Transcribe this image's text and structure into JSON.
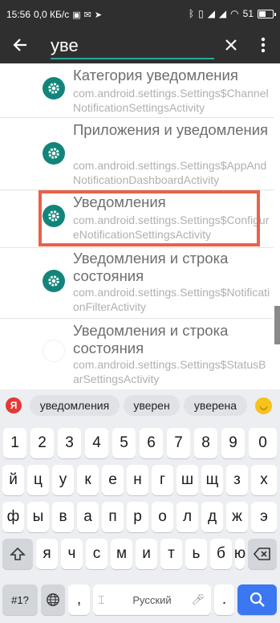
{
  "status": {
    "time": "15:56",
    "speed": "0,0 КБ/с",
    "battery": "51",
    "battery_level": 0.51
  },
  "search": {
    "query": "уве"
  },
  "results": [
    {
      "title": "Категория уведомления",
      "subtitle": "com.android.settings.Settings$ChannelNotificationSettingsActivity",
      "icon": "gear-icon"
    },
    {
      "title": "Приложения и уведомления",
      "subtitle": "com.android.settings.Settings$AppAndNotificationDashboardActivity",
      "icon": "gear-icon"
    },
    {
      "title": "Уведомления",
      "subtitle": "com.android.settings.Settings$ConfigureNotificationSettingsActivity",
      "icon": "gear-icon",
      "highlighted": true
    },
    {
      "title": "Уведомления и строка состояния",
      "subtitle": "com.android.settings.Settings$NotificationFilterActivity",
      "icon": "gear-icon"
    },
    {
      "title": "Уведомления и строка состояния",
      "subtitle": "com.android.settings.Settings$StatusBarSettingsActivity",
      "icon": "blank-icon"
    }
  ],
  "keyboard": {
    "logo": "Я",
    "suggestions": [
      "уведомления",
      "уверен",
      "уверена"
    ],
    "row_numbers": [
      "1",
      "2",
      "3",
      "4",
      "5",
      "6",
      "7",
      "8",
      "9",
      "0"
    ],
    "row1": [
      "й",
      "ц",
      "у",
      "к",
      "е",
      "н",
      "г",
      "ш",
      "щ",
      "з",
      "х"
    ],
    "row2": [
      "ф",
      "ы",
      "в",
      "а",
      "п",
      "р",
      "о",
      "л",
      "д",
      "ж",
      "э"
    ],
    "row3": [
      "я",
      "ч",
      "с",
      "м",
      "и",
      "т",
      "ь",
      "б",
      "ю"
    ],
    "symbols_label": "#1?",
    "comma": ",",
    "space_label": "Русский",
    "period": "."
  },
  "colors": {
    "accent": "#12857a",
    "highlight": "#e9614b",
    "search_key": "#3a77f0"
  }
}
